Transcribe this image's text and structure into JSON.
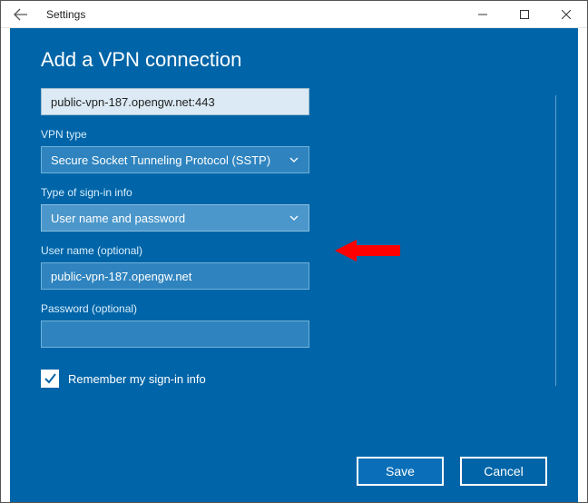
{
  "titlebar": {
    "title": "Settings"
  },
  "dialog": {
    "heading": "Add a VPN connection",
    "server_value": "public-vpn-187.opengw.net:443",
    "vpntype_label": "VPN type",
    "vpntype_value": "Secure Socket Tunneling Protocol (SSTP)",
    "signin_label": "Type of sign-in info",
    "signin_value": "User name and password",
    "username_label": "User name (optional)",
    "username_value": "public-vpn-187.opengw.net",
    "password_label": "Password (optional)",
    "password_value": "",
    "remember_label": "Remember my sign-in info",
    "save_label": "Save",
    "cancel_label": "Cancel"
  }
}
